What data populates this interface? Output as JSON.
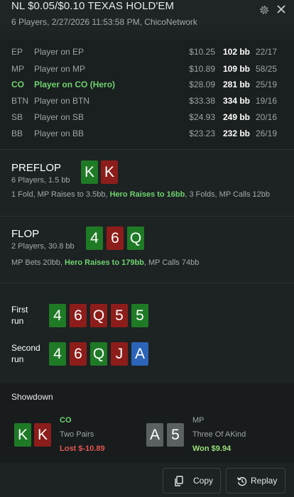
{
  "header": {
    "title": "NL $0.05/$0.10 TEXAS HOLD'EM",
    "subtitle": "6 Players, 2/27/2026 11:53:58 PM, ChicoNetwork"
  },
  "players": [
    {
      "pos": "EP",
      "name": "Player on EP",
      "stack": "$10.25",
      "bb": "102 bb",
      "hands": "22/17",
      "hero": false
    },
    {
      "pos": "MP",
      "name": "Player on MP",
      "stack": "$10.89",
      "bb": "109 bb",
      "hands": "58/25",
      "hero": false
    },
    {
      "pos": "CO",
      "name": "Player on CO (Hero)",
      "stack": "$28.09",
      "bb": "281 bb",
      "hands": "25/19",
      "hero": true
    },
    {
      "pos": "BTN",
      "name": "Player on BTN",
      "stack": "$33.38",
      "bb": "334 bb",
      "hands": "19/16",
      "hero": false
    },
    {
      "pos": "SB",
      "name": "Player on SB",
      "stack": "$24.93",
      "bb": "249 bb",
      "hands": "20/16",
      "hero": false
    },
    {
      "pos": "BB",
      "name": "Player on BB",
      "stack": "$23.23",
      "bb": "232 bb",
      "hands": "26/19",
      "hero": false
    }
  ],
  "preflop": {
    "title": "PREFLOP",
    "sub": "6 Players, 1.5 bb",
    "cards": [
      {
        "rank": "K",
        "suit": "s"
      },
      {
        "rank": "K",
        "suit": "h"
      }
    ],
    "action_a": "1 Fold, MP Raises to 3.5bb, ",
    "action_hl": "Hero Raises to 16bb",
    "action_b": ", 3 Folds, MP Calls 12bb"
  },
  "flop": {
    "title": "FLOP",
    "sub": "2 Players, 30.8 bb",
    "cards": [
      {
        "rank": "4",
        "suit": "s"
      },
      {
        "rank": "6",
        "suit": "h"
      },
      {
        "rank": "Q",
        "suit": "s"
      }
    ],
    "action_a": "MP Bets 20bb, ",
    "action_hl": "Hero Raises to 179bb",
    "action_b": ", MP Calls 74bb"
  },
  "runs": {
    "first_label_1": "First",
    "first_label_2": "run",
    "first_cards": [
      {
        "rank": "4",
        "suit": "s"
      },
      {
        "rank": "6",
        "suit": "h"
      },
      {
        "rank": "Q",
        "suit": "h"
      },
      {
        "rank": "5",
        "suit": "h"
      },
      {
        "rank": "5",
        "suit": "s"
      }
    ],
    "second_label_1": "Second",
    "second_label_2": "run",
    "second_cards": [
      {
        "rank": "4",
        "suit": "s"
      },
      {
        "rank": "6",
        "suit": "h"
      },
      {
        "rank": "Q",
        "suit": "s"
      },
      {
        "rank": "J",
        "suit": "h"
      },
      {
        "rank": "A",
        "suit": "d"
      }
    ]
  },
  "showdown": {
    "title": "Showdown",
    "hero": {
      "pos": "CO",
      "hand": "Two Pairs",
      "result": "Lost $-10.89",
      "cards": [
        {
          "rank": "K",
          "suit": "s"
        },
        {
          "rank": "K",
          "suit": "h"
        }
      ]
    },
    "villain": {
      "pos": "MP",
      "hand": "Three Of AKind",
      "result": "Won $9.94",
      "cards": [
        {
          "rank": "A",
          "suit": "c"
        },
        {
          "rank": "5",
          "suit": "c"
        }
      ]
    }
  },
  "buttons": {
    "copy": "Copy",
    "replay": "Replay"
  },
  "colors": {
    "accent_green": "#6fd36f",
    "loss_red": "#e0584f",
    "spade": "#1f7a26",
    "heart": "#8d1d1a",
    "diamond": "#2b64b8",
    "club": "#5b6162"
  }
}
